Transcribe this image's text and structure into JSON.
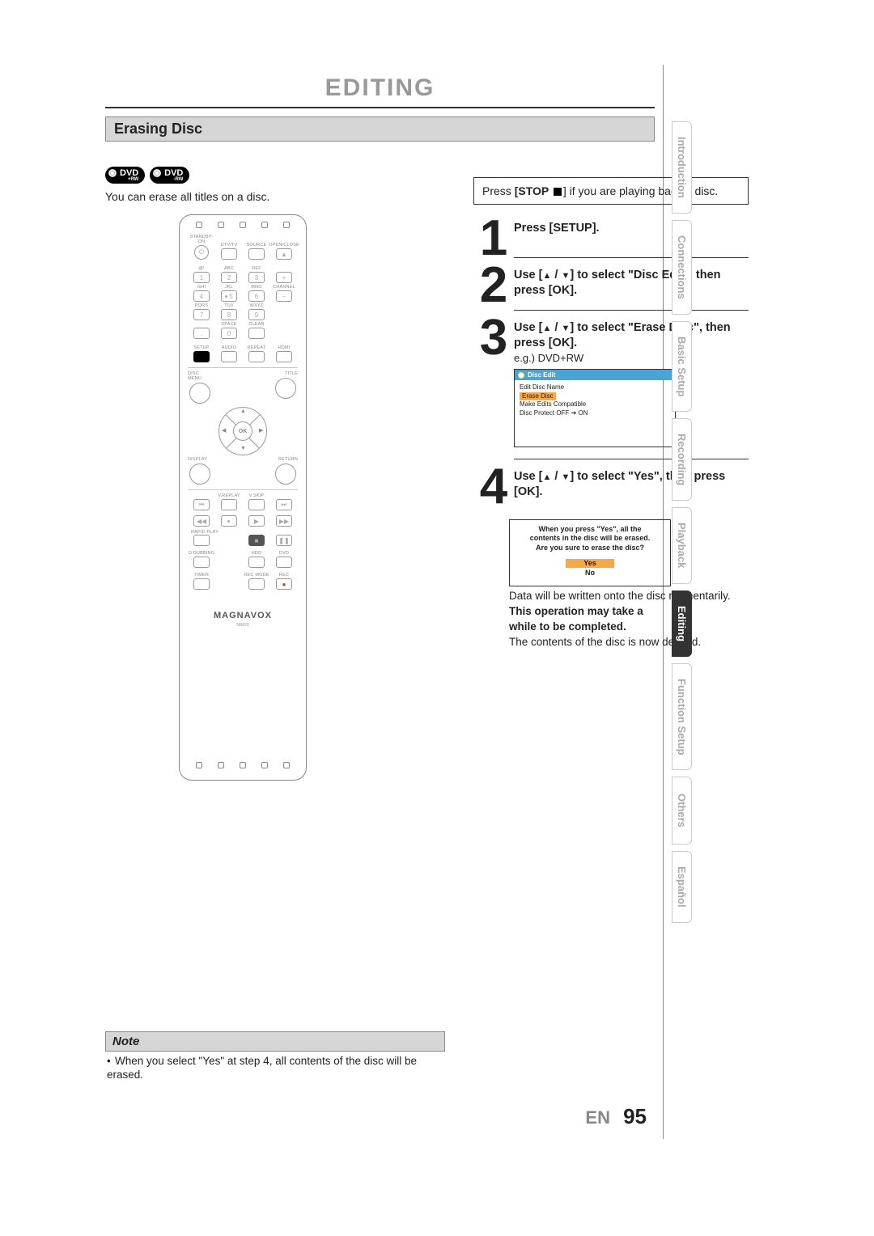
{
  "chapter": "EDITING",
  "section": "Erasing Disc",
  "badges": [
    {
      "label": "DVD",
      "sub": "+RW"
    },
    {
      "label": "DVD",
      "sub": "-RW"
    }
  ],
  "intro": "You can erase all titles on a disc.",
  "prestep": {
    "prefix": "Press ",
    "button": "[STOP ",
    "suffix": "] if you are playing back a disc."
  },
  "steps": {
    "s1": {
      "num": "1",
      "title": "Press [SETUP]."
    },
    "s2": {
      "num": "2",
      "title_pre": "Use [",
      "title_mid": " / ",
      "title_post": "] to select \"Disc Edit\", then press [OK]."
    },
    "s3": {
      "num": "3",
      "title_pre": "Use [",
      "title_mid": " / ",
      "title_post": "] to select \"Erase Disc\", then press [OK].",
      "sub": "e.g.) DVD+RW",
      "osd_title": "Disc Edit",
      "osd_items": [
        "Edit Disc Name",
        "Erase Disc",
        "Make Edits Compatible",
        "Disc Protect OFF ➔ ON"
      ],
      "osd_selected_index": 1
    },
    "s4": {
      "num": "4",
      "title_pre": "Use [",
      "title_mid": " / ",
      "title_post": "] to select \"Yes\", then press [OK].",
      "dialog_lines": [
        "When you press \"Yes\", all the",
        "contents in the disc will be erased.",
        "Are you sure to erase the disc?"
      ],
      "dialog_yes": "Yes",
      "dialog_no": "No",
      "after1": "Data will be written onto the disc momentarily.",
      "after_bold1": "This operation may take a",
      "after_bold2": "while to be completed.",
      "after2": "The contents of the disc is now deleted."
    }
  },
  "note": {
    "head": "Note",
    "body_bullet": "•",
    "body": "When you select \"Yes\" at step 4, all contents of the disc will be erased."
  },
  "remote": {
    "brand": "MAGNAVOX",
    "model": "NB820",
    "row1": [
      "STANDBY-ON",
      "DTV/TV",
      "SOURCE",
      "OPEN/CLOSE"
    ],
    "numrow1_lbl": [
      "@!",
      "ABC",
      "DEF",
      ""
    ],
    "numrow1": [
      "1",
      "2",
      "3",
      "+"
    ],
    "numrow2_lbl": [
      "GHI",
      "JKL",
      "MNO",
      "CHANNEL"
    ],
    "numrow2": [
      "4",
      "5",
      "6",
      "−"
    ],
    "numrow3_lbl": [
      "PQRS",
      "TUV",
      "WXYZ",
      ""
    ],
    "numrow3": [
      "7",
      "8",
      "9",
      ""
    ],
    "numrow4_lbl": [
      "",
      "SPACE",
      "CLEAR",
      ""
    ],
    "numrow4": [
      ".",
      "0",
      "",
      ""
    ],
    "modeRow_lbl": [
      "SETUP",
      "AUDIO",
      "REPEAT",
      "HDMI"
    ],
    "navTop": "DISC MENU",
    "navTopR": "TITLE",
    "navBot": "DISPLAY",
    "navBotR": "RETURN",
    "ok": "OK",
    "trRow_lbl": [
      "",
      "V.REPLAY",
      "V.SKIP",
      ""
    ],
    "rapid": "RAPID PLAY",
    "dub": "D.DUBBING",
    "hdd": "HDD",
    "dvd": "DVD",
    "timer": "TIMER",
    "recmode": "REC MODE",
    "rec": "REC"
  },
  "tabs": [
    "Introduction",
    "Connections",
    "Basic Setup",
    "Recording",
    "Playback",
    "Editing",
    "Function Setup",
    "Others",
    "Español"
  ],
  "active_tab_index": 5,
  "footer": {
    "lang": "EN",
    "page": "95"
  }
}
